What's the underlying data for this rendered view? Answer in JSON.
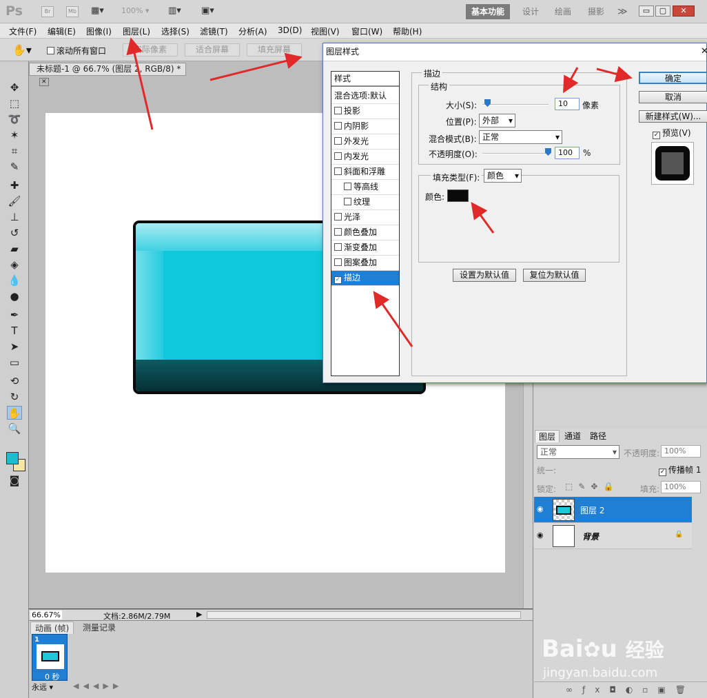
{
  "app": {
    "logo": "Ps",
    "launch_bridge": "Br",
    "launch_minibridge": "Mb",
    "zoom_display": "100%",
    "workspaces": [
      "基本功能",
      "设计",
      "绘画",
      "摄影"
    ],
    "more": "≫"
  },
  "menu": [
    "文件(F)",
    "编辑(E)",
    "图像(I)",
    "图层(L)",
    "选择(S)",
    "滤镜(T)",
    "分析(A)",
    "3D(D)",
    "视图(V)",
    "窗口(W)",
    "帮助(H)"
  ],
  "options": {
    "scroll_all": "滚动所有窗口",
    "actual_pixels": "实际像素",
    "fit_screen": "适合屏幕",
    "fill_screen": "填充屏幕"
  },
  "document": {
    "tab_title": "未标题-1 @ 66.7% (图层 2, RGB/8) *",
    "zoom": "66.67%",
    "doc_info": "文档:2.86M/2.79M"
  },
  "anim_panel": {
    "tabs": [
      "动画 (帧)",
      "测量记录"
    ],
    "frame_number": "1",
    "frame_time": "0 秒",
    "loop": "永远"
  },
  "layers_panel": {
    "tabs": [
      "图层",
      "通道",
      "路径"
    ],
    "blend_mode": "正常",
    "opacity_label": "不透明度:",
    "opacity": "100%",
    "unify_label": "统一:",
    "propagate": "传播帧 1",
    "lock_label": "锁定:",
    "fill_label": "填充:",
    "fill": "100%",
    "layers": [
      {
        "name": "图层 2",
        "selected": true
      },
      {
        "name": "背景",
        "locked": true
      }
    ]
  },
  "dialog": {
    "title": "图层样式",
    "styles_header": "样式",
    "styles": [
      {
        "label": "混合选项:默认",
        "checkbox": false
      },
      {
        "label": "投影",
        "checkbox": true,
        "checked": false
      },
      {
        "label": "内阴影",
        "checkbox": true,
        "checked": false
      },
      {
        "label": "外发光",
        "checkbox": true,
        "checked": false
      },
      {
        "label": "内发光",
        "checkbox": true,
        "checked": false
      },
      {
        "label": "斜面和浮雕",
        "checkbox": true,
        "checked": false
      },
      {
        "label": "等高线",
        "checkbox": true,
        "checked": false,
        "indent": true
      },
      {
        "label": "纹理",
        "checkbox": true,
        "checked": false,
        "indent": true
      },
      {
        "label": "光泽",
        "checkbox": true,
        "checked": false
      },
      {
        "label": "颜色叠加",
        "checkbox": true,
        "checked": false
      },
      {
        "label": "渐变叠加",
        "checkbox": true,
        "checked": false
      },
      {
        "label": "图案叠加",
        "checkbox": true,
        "checked": false
      },
      {
        "label": "描边",
        "checkbox": true,
        "checked": true,
        "selected": true
      }
    ],
    "stroke_group": "描边",
    "structure_group": "结构",
    "size_label": "大小(S):",
    "size_value": "10",
    "size_unit": "像素",
    "position_label": "位置(P):",
    "position_value": "外部",
    "blend_label": "混合模式(B):",
    "blend_value": "正常",
    "opacity_label": "不透明度(O):",
    "opacity_value": "100",
    "opacity_unit": "%",
    "fill_type_label": "填充类型(F):",
    "fill_type_value": "颜色",
    "color_label": "颜色:",
    "stroke_color": "#0a0a0a",
    "set_default": "设置为默认值",
    "reset_default": "复位为默认值",
    "ok": "确定",
    "cancel": "取消",
    "new_style": "新建样式(W)...",
    "preview": "预览(V)"
  },
  "watermark": {
    "brand": "Bai",
    "brand_cn": "经验",
    "url": "jingyan.baidu.com"
  },
  "colors": {
    "accent": "#1f7fd4",
    "button_cyan": "#0fc8dc",
    "arrow_red": "#e02a2a"
  }
}
